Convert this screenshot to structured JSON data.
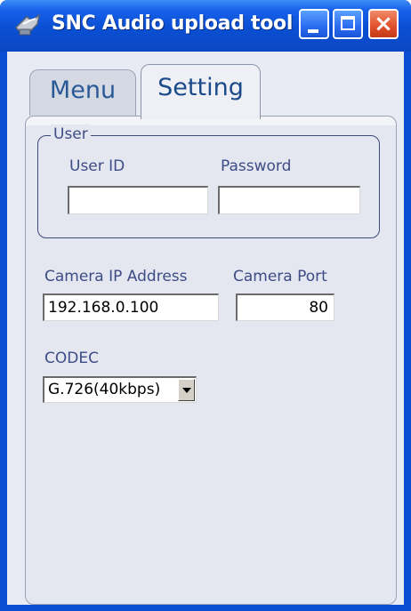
{
  "window": {
    "title": "SNC Audio upload tool",
    "colors": {
      "titlebar": "#0a4fd3",
      "close_button": "#e0502a",
      "label_text": "#3d4c86",
      "tab_text": "#1a4a8a"
    }
  },
  "tabs": [
    {
      "label": "Menu",
      "active": false
    },
    {
      "label": "Setting",
      "active": true
    }
  ],
  "user_group": {
    "title": "User",
    "user_id_label": "User ID",
    "user_id_value": "",
    "password_label": "Password",
    "password_value": ""
  },
  "camera": {
    "ip_label": "Camera IP Address",
    "ip_value": "192.168.0.100",
    "port_label": "Camera Port",
    "port_value": "80"
  },
  "codec": {
    "label": "CODEC",
    "selected": "G.726(40kbps)"
  },
  "icons": [
    "app-icon",
    "minimize-icon",
    "maximize-icon",
    "close-icon",
    "chevron-down-icon"
  ]
}
